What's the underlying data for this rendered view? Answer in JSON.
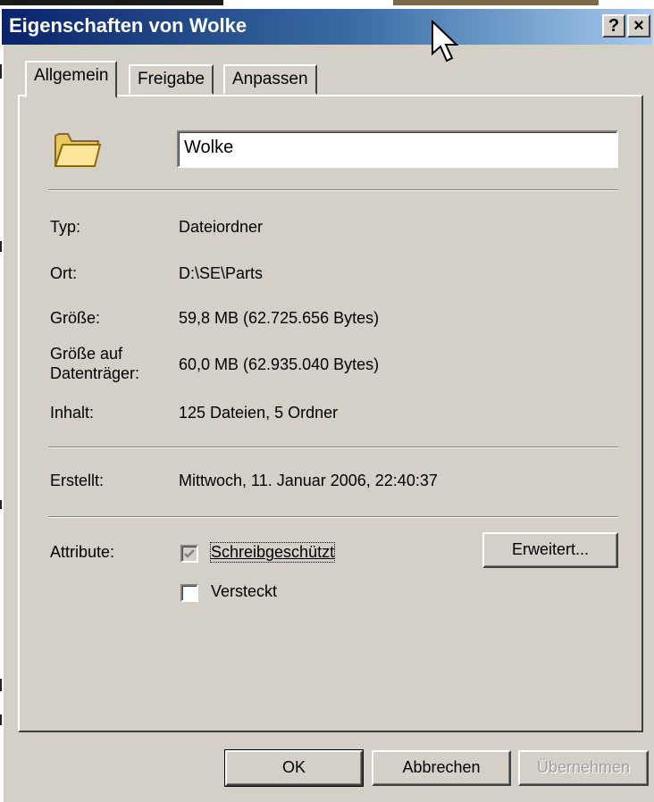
{
  "window": {
    "title": "Eigenschaften von Wolke",
    "help_label": "?",
    "close_label": "×"
  },
  "tabs": [
    {
      "label": "Allgemein"
    },
    {
      "label": "Freigabe"
    },
    {
      "label": "Anpassen"
    }
  ],
  "general": {
    "name_value": "Wolke",
    "type_label": "Typ:",
    "type_value": "Dateiordner",
    "location_label": "Ort:",
    "location_value": "D:\\SE\\Parts",
    "size_label": "Größe:",
    "size_value": "59,8 MB (62.725.656 Bytes)",
    "size_on_disk_label_1": "Größe auf",
    "size_on_disk_label_2": "Datenträger:",
    "size_on_disk_value": "60,0 MB (62.935.040 Bytes)",
    "contents_label": "Inhalt:",
    "contents_value": "125 Dateien, 5 Ordner",
    "created_label": "Erstellt:",
    "created_value": "Mittwoch, 11. Januar 2006, 22:40:37",
    "attributes_label": "Attribute:",
    "readonly_label": "Schreibgeschützt",
    "readonly_checked": true,
    "hidden_label": "Versteckt",
    "hidden_checked": false,
    "advanced_label": "Erweitert..."
  },
  "buttons": {
    "ok_label": "OK",
    "cancel_label": "Abbrechen",
    "apply_label": "Übernehmen"
  },
  "icons": {
    "folder": "folder-icon",
    "cursor": "mouse-cursor-icon"
  }
}
